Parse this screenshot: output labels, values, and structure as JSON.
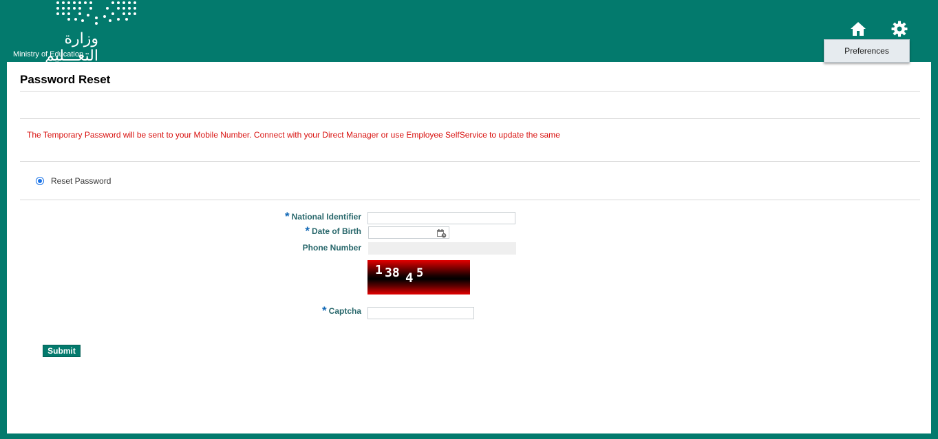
{
  "header": {
    "logo_ar": "وزارة التعـــليم",
    "logo_en": "Ministry of Education",
    "preferences_label": "Preferences"
  },
  "page": {
    "title": "Password Reset",
    "notice": "The Temporary Password will be sent to your Mobile Number. Connect with your Direct Manager or use Employee SelfService to update the same",
    "radio_label": "Reset Password"
  },
  "form": {
    "required_mark": "*",
    "national_id_label": "National Identifier",
    "national_id_value": "",
    "dob_label": "Date of Birth",
    "dob_value": "",
    "phone_label": "Phone Number",
    "phone_value": "",
    "captcha_chars": [
      "1",
      "38",
      "4",
      "5"
    ],
    "captcha_label": "Captcha",
    "captcha_value": "",
    "submit_label": "Submit"
  },
  "colors": {
    "brand": "#037a6d",
    "notice": "#d8110f",
    "label": "#28676b",
    "required": "#1168b6"
  },
  "icons": [
    "home-icon",
    "gear-icon",
    "calendar-icon"
  ]
}
